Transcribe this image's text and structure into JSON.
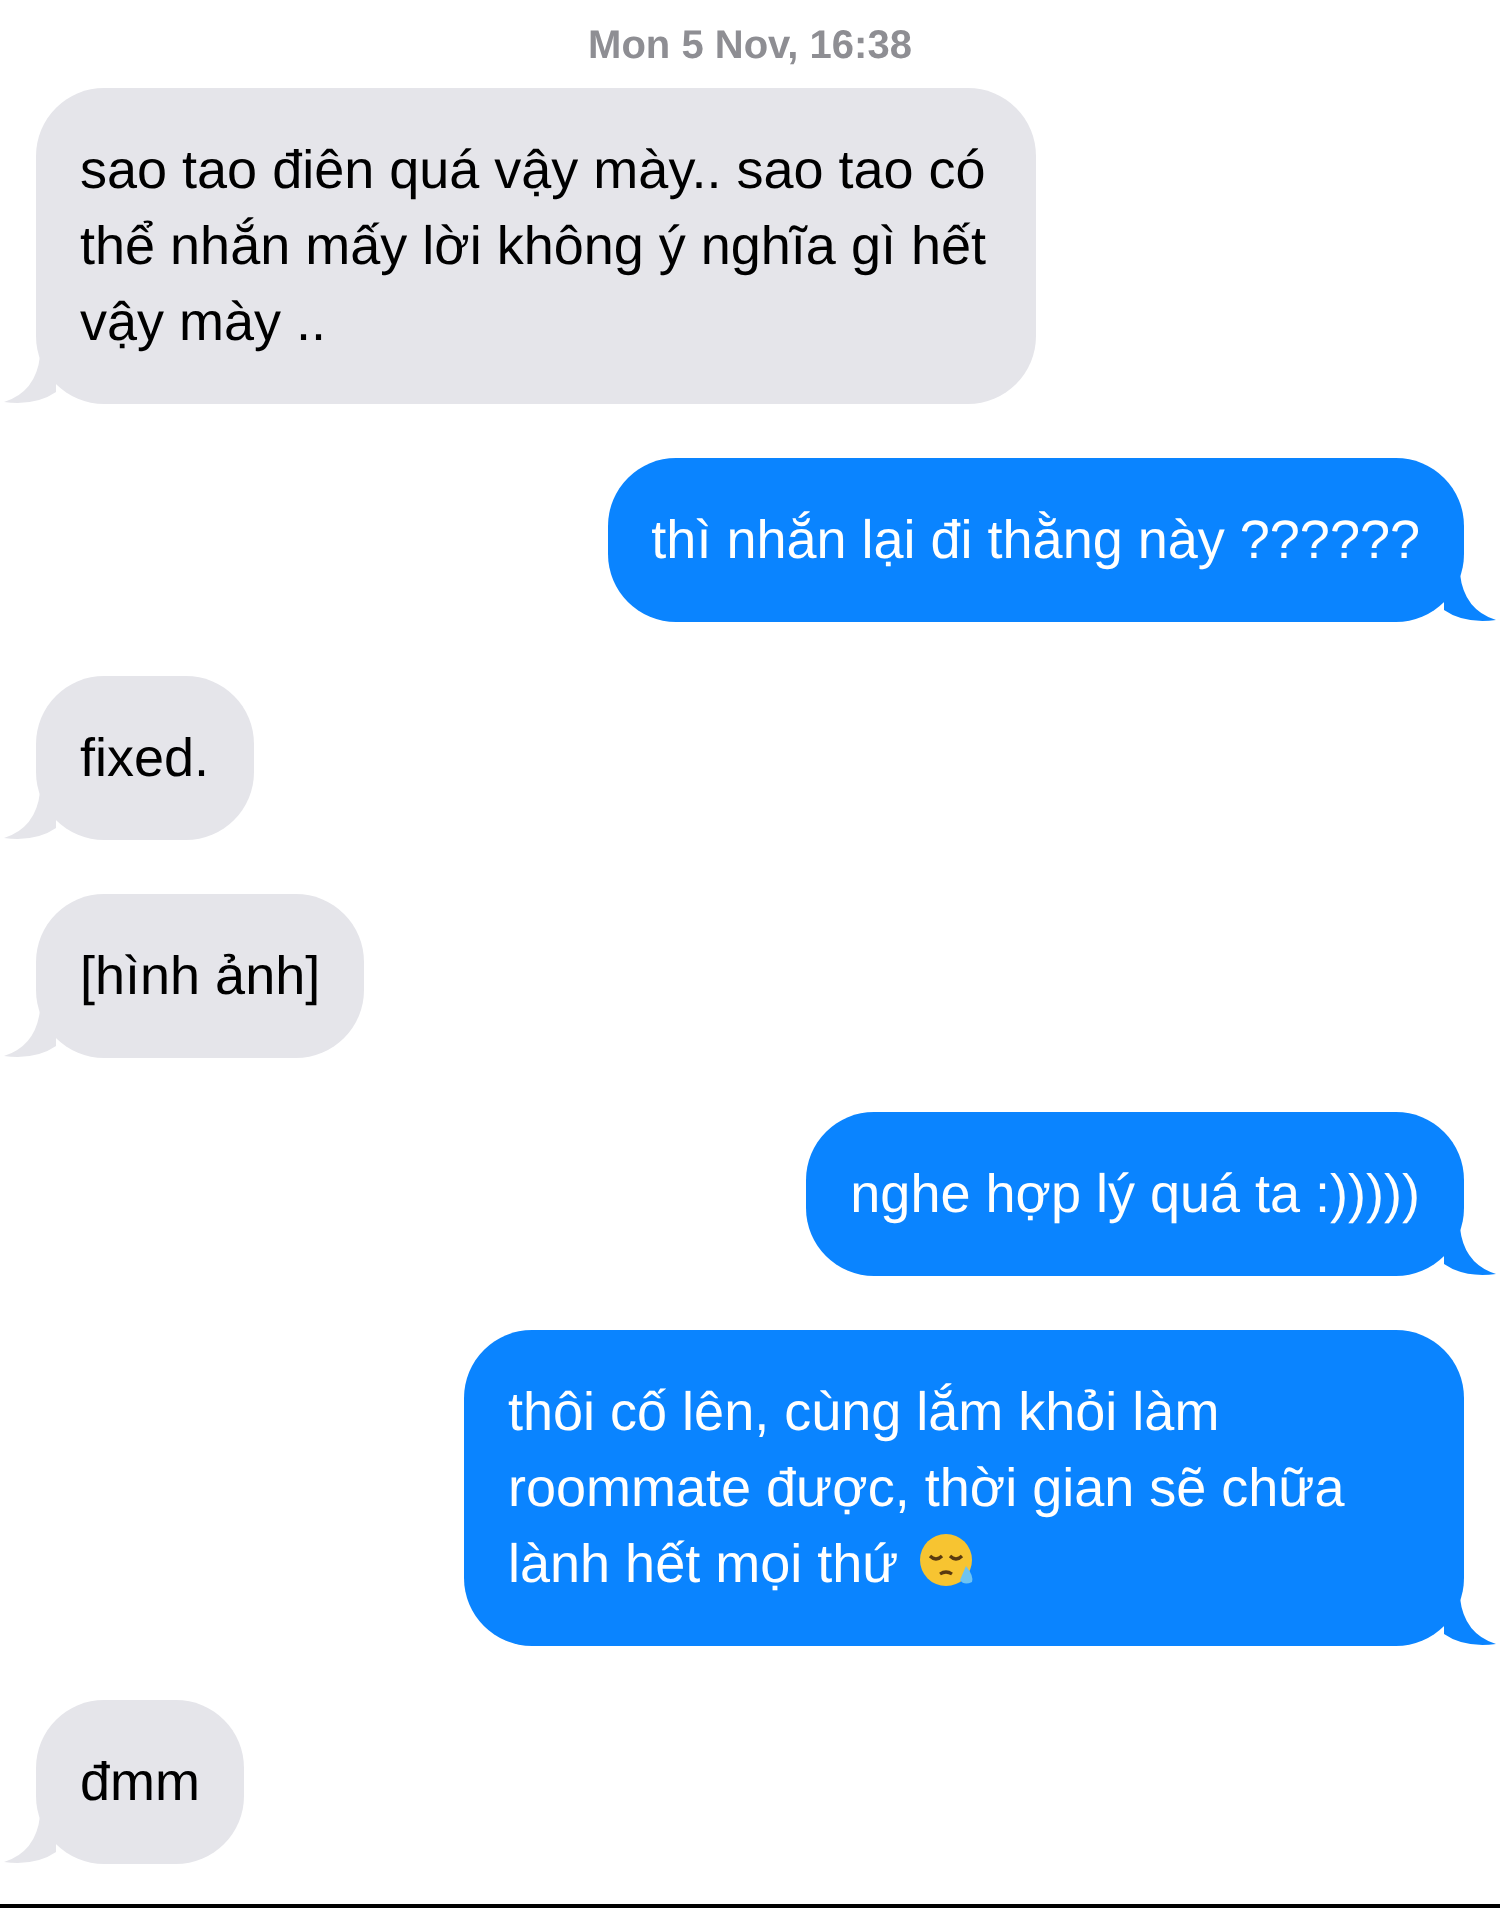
{
  "timestamp": "Mon 5 Nov, 16:38",
  "messages": [
    {
      "kind": "incoming",
      "text": "sao tao điên quá vậy mày.. sao tao có thể nhắn mấy lời không ý nghĩa gì hết vậy mày ..",
      "has_emoji": false
    },
    {
      "kind": "outgoing",
      "text": "thì nhắn lại đi thằng này  ??????",
      "has_emoji": false
    },
    {
      "kind": "incoming",
      "text": "fixed.",
      "has_emoji": false
    },
    {
      "kind": "incoming",
      "text": "[hình ảnh]",
      "has_emoji": false
    },
    {
      "kind": "outgoing",
      "text": "nghe hợp lý quá ta :)))))",
      "has_emoji": false
    },
    {
      "kind": "outgoing",
      "text": "thôi cố lên, cùng lắm khỏi làm roommate được, thời gian sẽ chữa lành hết mọi thứ",
      "has_emoji": true
    },
    {
      "kind": "incoming",
      "text": "đmm",
      "has_emoji": false
    }
  ]
}
